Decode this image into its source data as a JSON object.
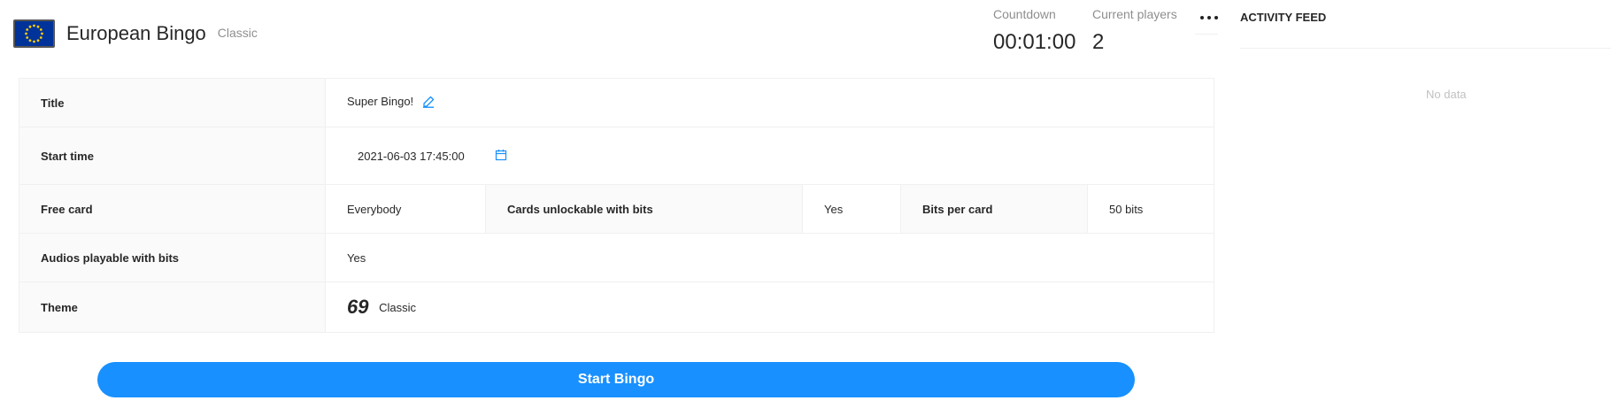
{
  "header": {
    "title": "European Bingo",
    "subtitle": "Classic"
  },
  "stats": {
    "countdown": {
      "label": "Countdown",
      "value": "00:01:00"
    },
    "players": {
      "label": "Current players",
      "value": "2"
    }
  },
  "activity": {
    "title": "ACTIVITY FEED",
    "empty_text": "No data"
  },
  "details": {
    "title": {
      "label": "Title",
      "value": "Super Bingo!"
    },
    "start_time": {
      "label": "Start time",
      "value": "2021-06-03 17:45:00"
    },
    "free_card": {
      "label": "Free card",
      "value": "Everybody"
    },
    "cards_unlockable": {
      "label": "Cards unlockable with bits",
      "value": "Yes"
    },
    "bits_per_card": {
      "label": "Bits per card",
      "value": "50 bits"
    },
    "audios": {
      "label": "Audios playable with bits",
      "value": "Yes"
    },
    "theme": {
      "label": "Theme",
      "number": "69",
      "name": "Classic"
    }
  },
  "actions": {
    "start_label": "Start Bingo"
  },
  "colors": {
    "accent": "#1890ff",
    "flag_blue": "#003399",
    "flag_star": "#ffcc00"
  },
  "icons": {
    "flag": "eu-flag-icon",
    "edit": "edit-icon",
    "calendar": "calendar-icon",
    "more": "more-icon"
  }
}
